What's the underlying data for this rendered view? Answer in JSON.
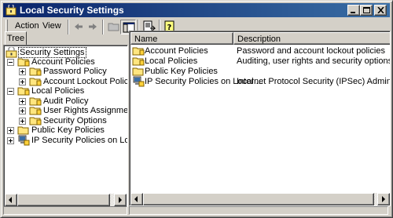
{
  "window": {
    "title": "Local Security Settings"
  },
  "menu": {
    "action_label": "Action",
    "view_label": "View"
  },
  "tree": {
    "tab_label": "Tree",
    "items": [
      {
        "label": "Security Settings",
        "icon": "security-settings-icon"
      },
      {
        "label": "Account Policies",
        "icon": "folder-icon"
      },
      {
        "label": "Password Policy",
        "icon": "folder-icon"
      },
      {
        "label": "Account Lockout Policy",
        "icon": "folder-icon"
      },
      {
        "label": "Local Policies",
        "icon": "folder-icon"
      },
      {
        "label": "Audit Policy",
        "icon": "folder-icon"
      },
      {
        "label": "User Rights Assignment",
        "icon": "folder-icon"
      },
      {
        "label": "Security Options",
        "icon": "folder-icon"
      },
      {
        "label": "Public Key Policies",
        "icon": "folder-icon"
      },
      {
        "label": "IP Security Policies on Local Mach",
        "icon": "ipsec-policy-icon"
      }
    ]
  },
  "list": {
    "columns": [
      "Name",
      "Description"
    ],
    "rows": [
      {
        "name": "Account Policies",
        "description": "Password and account lockout policies",
        "icon": "folder-icon"
      },
      {
        "name": "Local Policies",
        "description": "Auditing, user rights and security options policies",
        "icon": "folder-icon"
      },
      {
        "name": "Public Key Policies",
        "description": "",
        "icon": "folder-icon"
      },
      {
        "name": "IP Security Policies on Local ...",
        "description": "Internet Protocol Security (IPSec) Administration. ...",
        "icon": "ipsec-policy-icon"
      }
    ]
  },
  "colors": {
    "title_bar_start": "#0a246a",
    "title_bar_end": "#3a6ea5",
    "chrome": "#d4d0c8",
    "folder": "#ffe680"
  }
}
